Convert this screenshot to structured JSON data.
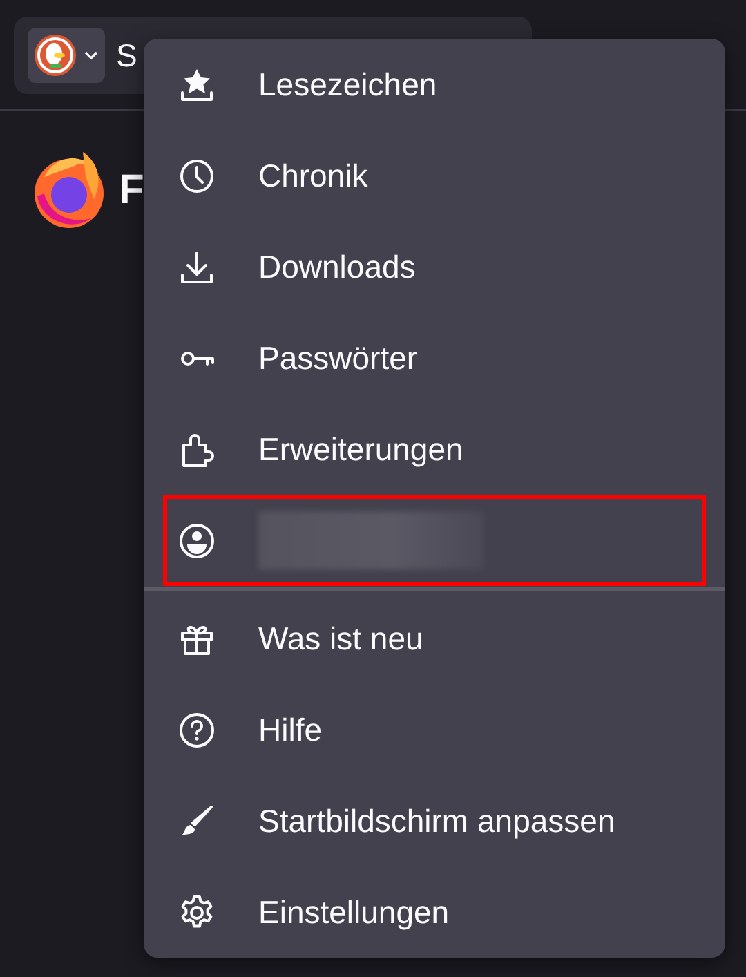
{
  "toolbar": {
    "address_text": "S"
  },
  "page": {
    "heading": "F"
  },
  "menu": {
    "items": [
      {
        "kind": "item",
        "label": "Lesezeichen"
      },
      {
        "kind": "item",
        "label": "Chronik"
      },
      {
        "kind": "item",
        "label": "Downloads"
      },
      {
        "kind": "item",
        "label": "Passwörter"
      },
      {
        "kind": "item",
        "label": "Erweiterungen"
      },
      {
        "kind": "account",
        "redacted": true,
        "highlighted": true
      },
      {
        "kind": "divider"
      },
      {
        "kind": "item",
        "label": "Was ist neu"
      },
      {
        "kind": "item",
        "label": "Hilfe"
      },
      {
        "kind": "item",
        "label": "Startbildschirm anpassen"
      },
      {
        "kind": "item",
        "label": "Einstellungen"
      }
    ]
  }
}
